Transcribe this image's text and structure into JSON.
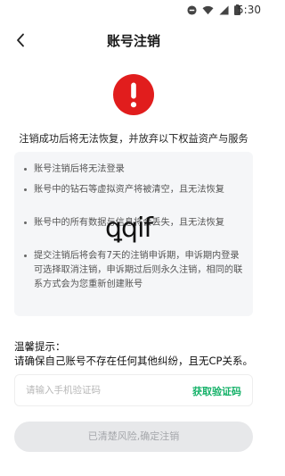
{
  "status_bar": {
    "time": "5:30",
    "icons": [
      "dnd-icon",
      "wifi-icon",
      "signal-icon",
      "battery-icon"
    ]
  },
  "header": {
    "title": "账号注销",
    "back_icon": "chevron-left-icon"
  },
  "warning": {
    "icon": "exclamation-icon",
    "icon_color": "#e11d1d",
    "text": "注销成功后将无法恢复，并放弃以下权益资产与服务"
  },
  "rules": [
    "账号注销后将无法登录",
    "账号中的钻石等虚拟资产将被清空，且无法恢复",
    "账号中的所有数据与信息将会丢失，且无法恢复",
    "提交注销后将会有7天的注销申诉期，申诉期内登录可选择取消注销，申诉期过后则永久注销，相同的联系方式会为您重新创建账号"
  ],
  "watermark": "ꝗqif",
  "tips": {
    "title": "温馨提示：",
    "text": "请确保自己账号不存在任何其他纠纷，且无CP关系。"
  },
  "code_input": {
    "value": "",
    "placeholder": "请输入手机验证码",
    "button_label": "获取验证码",
    "button_color": "#17b26a"
  },
  "confirm_button": {
    "label": "已清楚风险,确定注销"
  }
}
